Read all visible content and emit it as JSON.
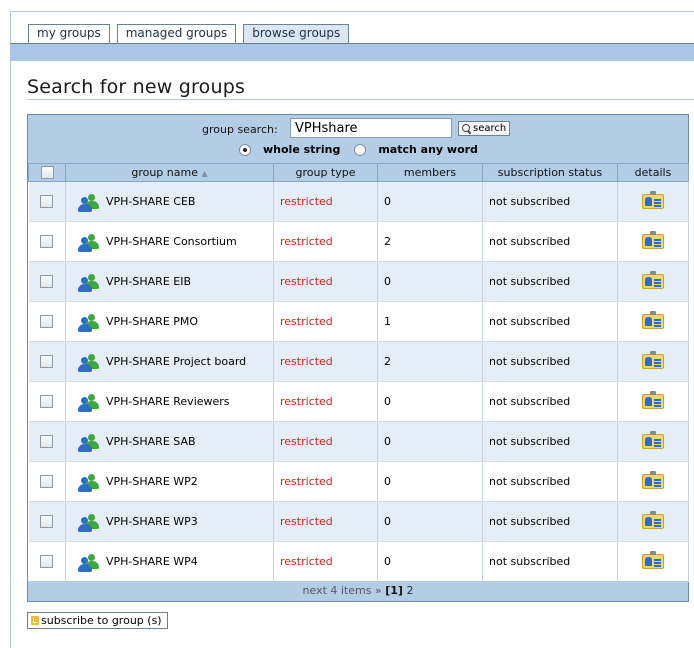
{
  "tabs": [
    {
      "label": "my groups",
      "active": false
    },
    {
      "label": "managed groups",
      "active": false
    },
    {
      "label": "browse groups",
      "active": true
    }
  ],
  "page_title": "Search for new groups",
  "search": {
    "label": "group search:",
    "value": "VPHshare",
    "button_label": "search",
    "options": [
      "whole string",
      "match any word"
    ],
    "selected_option": "whole string"
  },
  "columns": [
    "group name",
    "group type",
    "members",
    "subscription status",
    "details"
  ],
  "rows": [
    {
      "name": "VPH-SHARE CEB",
      "type": "restricted",
      "members": "0",
      "status": "not subscribed"
    },
    {
      "name": "VPH-SHARE Consortium",
      "type": "restricted",
      "members": "2",
      "status": "not subscribed"
    },
    {
      "name": "VPH-SHARE EIB",
      "type": "restricted",
      "members": "0",
      "status": "not subscribed"
    },
    {
      "name": "VPH-SHARE PMO",
      "type": "restricted",
      "members": "1",
      "status": "not subscribed"
    },
    {
      "name": "VPH-SHARE Project board",
      "type": "restricted",
      "members": "2",
      "status": "not subscribed"
    },
    {
      "name": "VPH-SHARE Reviewers",
      "type": "restricted",
      "members": "0",
      "status": "not subscribed"
    },
    {
      "name": "VPH-SHARE SAB",
      "type": "restricted",
      "members": "0",
      "status": "not subscribed"
    },
    {
      "name": "VPH-SHARE WP2",
      "type": "restricted",
      "members": "0",
      "status": "not subscribed"
    },
    {
      "name": "VPH-SHARE WP3",
      "type": "restricted",
      "members": "0",
      "status": "not subscribed"
    },
    {
      "name": "VPH-SHARE WP4",
      "type": "restricted",
      "members": "0",
      "status": "not subscribed"
    }
  ],
  "pagination": {
    "next_label": "next 4 items »",
    "current_page": "[1]",
    "other_page": "2"
  },
  "subscribe_button": "subscribe to group (s)",
  "colors": {
    "header_bg": "#b4cde6",
    "row_alt_bg": "#e5edf6",
    "restricted": "#e0201a"
  }
}
